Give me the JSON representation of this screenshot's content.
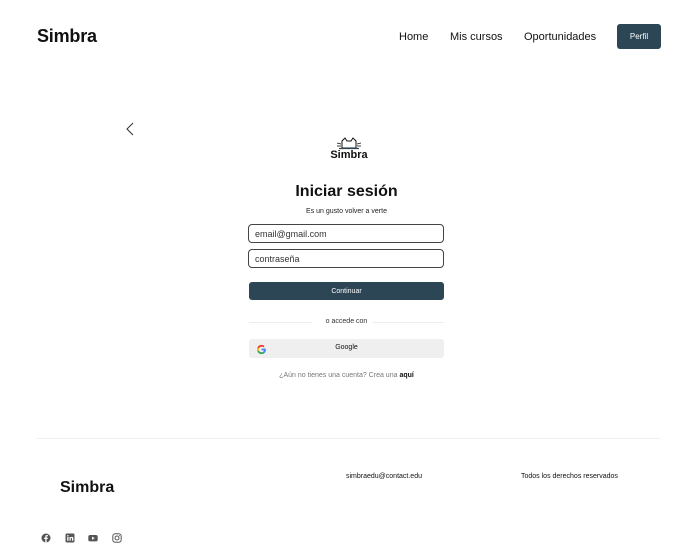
{
  "header": {
    "brand": "Simbra",
    "nav": [
      "Home",
      "Mis cursos",
      "Oportunidades"
    ],
    "profile_button": "Perfil"
  },
  "login": {
    "logo_text": "Simbra",
    "title": "Iniciar sesión",
    "subtitle": "Es un gusto volver a verte",
    "email_placeholder": "email@gmail.com",
    "password_placeholder": "contraseña",
    "continue_button": "Continuar",
    "divider_text": "o accede con",
    "google_button": "Google",
    "signup_prompt": "¿Aún no tienes una cuenta? Crea una",
    "signup_link": "aquí"
  },
  "footer": {
    "brand": "Simbra",
    "email": "simbraedu@contact.edu",
    "rights": "Todos los derechos reservados",
    "social_icons": [
      "facebook-icon",
      "linkedin-icon",
      "youtube-icon",
      "instagram-icon"
    ]
  },
  "colors": {
    "primary": "#2c4656",
    "input_border": "#444444",
    "google_bg": "#efefef",
    "divider": "#ececec"
  }
}
